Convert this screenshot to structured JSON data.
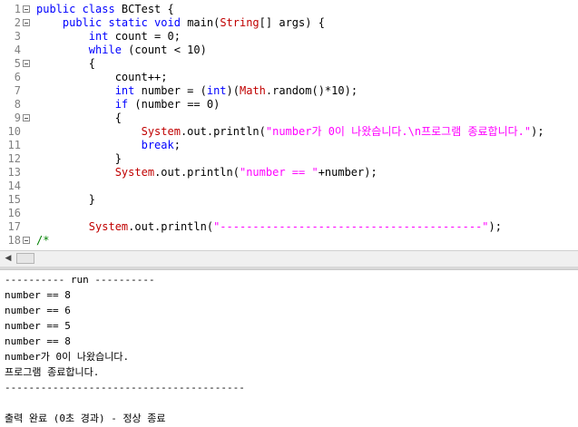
{
  "editor": {
    "lines": [
      {
        "num": "1",
        "fold": true,
        "tokens": [
          {
            "t": "kw",
            "v": "public class "
          },
          {
            "t": "txt",
            "v": "BCTest {"
          }
        ]
      },
      {
        "num": "2",
        "fold": true,
        "tokens": [
          {
            "t": "txt",
            "v": "    "
          },
          {
            "t": "kw",
            "v": "public static void "
          },
          {
            "t": "txt",
            "v": "main("
          },
          {
            "t": "cls",
            "v": "String"
          },
          {
            "t": "txt",
            "v": "[] args) {"
          }
        ]
      },
      {
        "num": "3",
        "fold": false,
        "tokens": [
          {
            "t": "txt",
            "v": "        "
          },
          {
            "t": "kw",
            "v": "int "
          },
          {
            "t": "txt",
            "v": "count = 0;"
          }
        ]
      },
      {
        "num": "4",
        "fold": false,
        "tokens": [
          {
            "t": "txt",
            "v": "        "
          },
          {
            "t": "kw",
            "v": "while "
          },
          {
            "t": "txt",
            "v": "(count < 10)"
          }
        ]
      },
      {
        "num": "5",
        "fold": true,
        "tokens": [
          {
            "t": "txt",
            "v": "        {"
          }
        ]
      },
      {
        "num": "6",
        "fold": false,
        "tokens": [
          {
            "t": "txt",
            "v": "            count++;"
          }
        ]
      },
      {
        "num": "7",
        "fold": false,
        "tokens": [
          {
            "t": "txt",
            "v": "            "
          },
          {
            "t": "kw",
            "v": "int "
          },
          {
            "t": "txt",
            "v": "number = ("
          },
          {
            "t": "kw",
            "v": "int"
          },
          {
            "t": "txt",
            "v": ")("
          },
          {
            "t": "cls",
            "v": "Math"
          },
          {
            "t": "txt",
            "v": ".random()*10);"
          }
        ]
      },
      {
        "num": "8",
        "fold": false,
        "tokens": [
          {
            "t": "txt",
            "v": "            "
          },
          {
            "t": "kw",
            "v": "if "
          },
          {
            "t": "txt",
            "v": "(number == 0)"
          }
        ]
      },
      {
        "num": "9",
        "fold": true,
        "tokens": [
          {
            "t": "txt",
            "v": "            {"
          }
        ]
      },
      {
        "num": "10",
        "fold": false,
        "tokens": [
          {
            "t": "txt",
            "v": "                "
          },
          {
            "t": "cls",
            "v": "System"
          },
          {
            "t": "txt",
            "v": ".out.println("
          },
          {
            "t": "str",
            "v": "\"number가 0이 나왔습니다.\\n프로그램 종료합니다.\""
          },
          {
            "t": "txt",
            "v": ");"
          }
        ]
      },
      {
        "num": "11",
        "fold": false,
        "tokens": [
          {
            "t": "txt",
            "v": "                "
          },
          {
            "t": "kw",
            "v": "break"
          },
          {
            "t": "txt",
            "v": ";"
          }
        ]
      },
      {
        "num": "12",
        "fold": false,
        "tokens": [
          {
            "t": "txt",
            "v": "            }"
          }
        ]
      },
      {
        "num": "13",
        "fold": false,
        "tokens": [
          {
            "t": "txt",
            "v": "            "
          },
          {
            "t": "cls",
            "v": "System"
          },
          {
            "t": "txt",
            "v": ".out.println("
          },
          {
            "t": "str",
            "v": "\"number == \""
          },
          {
            "t": "txt",
            "v": "+number);"
          }
        ]
      },
      {
        "num": "14",
        "fold": false,
        "tokens": []
      },
      {
        "num": "15",
        "fold": false,
        "tokens": [
          {
            "t": "txt",
            "v": "        }"
          }
        ]
      },
      {
        "num": "16",
        "fold": false,
        "tokens": []
      },
      {
        "num": "17",
        "fold": false,
        "tokens": [
          {
            "t": "txt",
            "v": "        "
          },
          {
            "t": "cls",
            "v": "System"
          },
          {
            "t": "txt",
            "v": ".out.println("
          },
          {
            "t": "str",
            "v": "\"----------------------------------------\""
          },
          {
            "t": "txt",
            "v": ");"
          }
        ]
      },
      {
        "num": "18",
        "fold": true,
        "tokens": [
          {
            "t": "cmt",
            "v": "/*"
          }
        ]
      }
    ]
  },
  "scrollbar": {
    "left_arrow_icon": "chevron-left-icon",
    "left_arrow_glyph": "◀"
  },
  "output": {
    "lines": [
      "---------- run ----------",
      "number == 8",
      "number == 6",
      "number == 5",
      "number == 8",
      "number가 0이 나왔습니다.",
      "프로그램 종료합니다.",
      "----------------------------------------",
      "",
      "출력 완료 (0초 경과) - 정상 종료"
    ]
  },
  "colors": {
    "keyword": "#0000ff",
    "string": "#ff00ff",
    "class": "#c00000",
    "comment": "#008000",
    "line_number": "#808080"
  }
}
